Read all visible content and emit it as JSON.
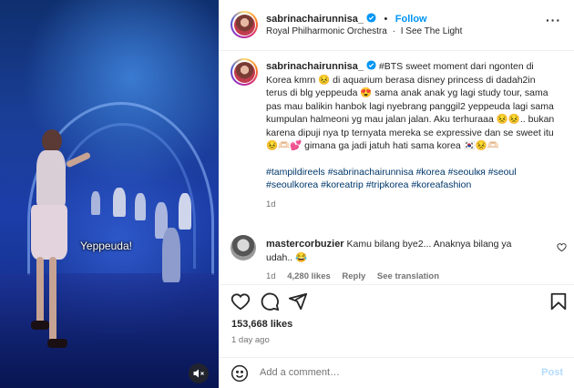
{
  "video": {
    "caption": "Yeppeuda!",
    "mute_icon": "speaker-muted-icon"
  },
  "header": {
    "username": "sabrinachairunnisa_",
    "follow_label": "Follow",
    "separator": "•",
    "audio_artist": "Royal Philharmonic Orchestra",
    "audio_title": "I See The Light",
    "audio_separator": "·",
    "more_label": "···"
  },
  "post": {
    "username": "sabrinachairunnisa_",
    "caption_text": "#BTS sweet moment dari ngonten di Korea kmrn 😣 di aquarium berasa disney princess di dadah2in terus di blg yeppeuda 😍 sama anak anak yg lagi study tour, sama pas mau balikin hanbok lagi nyebrang panggil2 yeppeuda lagi sama kumpulan halmeoni yg mau jalan jalan. Aku terhuraaa 😣😣.. bukan karena dipuji nya tp ternyata mereka se expressive dan se sweet itu 😣🫶🏻💕 gimana ga jadi jatuh hati sama korea 🇰🇷😣🫶🏻",
    "hashtags": "#tampildireels #sabrinachairunnisa #korea #seoulкя #seoul #seoulkorea #koreatrip #tripkorea #koreafashion",
    "time": "1d"
  },
  "comment": {
    "username": "mastercorbuzier",
    "text": "Kamu bilang bye2... Anaknya bilang ya udah.. 😂",
    "time": "1d",
    "likes": "4,280 likes",
    "reply_label": "Reply",
    "translation_label": "See translation"
  },
  "stats": {
    "likes": "153,668 likes",
    "posted": "1 day ago"
  },
  "comment_box": {
    "placeholder": "Add a comment…",
    "post_label": "Post"
  },
  "colors": {
    "accent": "#0095f6",
    "hashtag": "#00376b",
    "muted": "#737373"
  }
}
